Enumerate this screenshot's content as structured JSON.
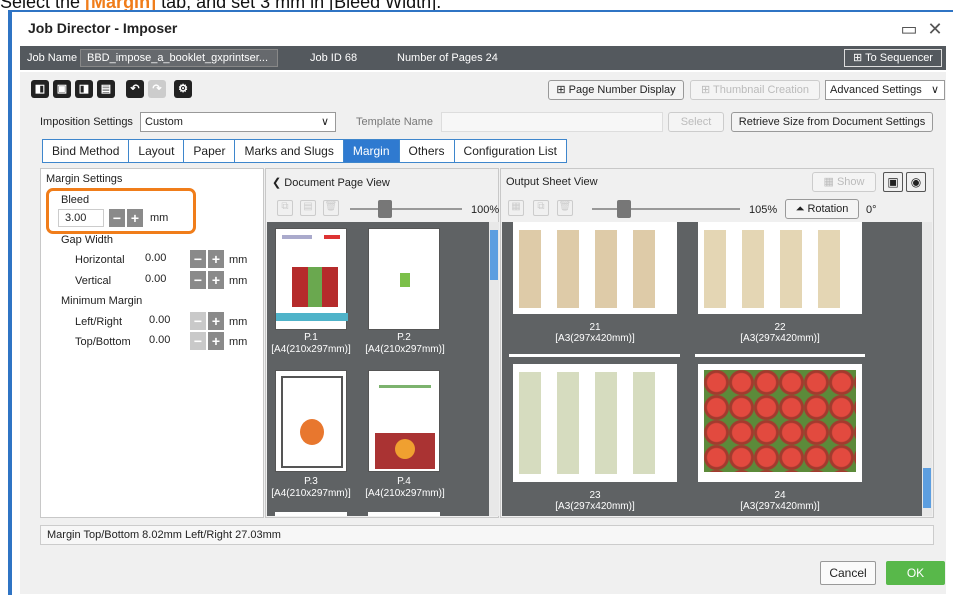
{
  "caption": {
    "prefix": "Select the ",
    "highlight": "[Margin]",
    "suffix": " tab, and set 3 mm in [Bleed Width]."
  },
  "window": {
    "title": "Job Director - Imposer",
    "maximize_icon": "maximize-icon",
    "close_icon": "close-icon"
  },
  "info": {
    "job_name_label": "Job Name",
    "job_name_value": "BBD_impose_a_booklet_gxprintser...",
    "job_id": "Job ID  68",
    "pages": "Number of Pages  24",
    "sequencer_btn": "To Sequencer"
  },
  "toolbar": {
    "page_number_display": "Page Number Display",
    "thumbnail_creation": "Thumbnail Creation",
    "advanced_settings": "Advanced Settings"
  },
  "settings": {
    "imposition_label": "Imposition Settings",
    "imposition_value": "Custom",
    "template_label": "Template Name",
    "select_btn": "Select",
    "retrieve_btn": "Retrieve Size from Document Settings"
  },
  "tabs": [
    "Bind Method",
    "Layout",
    "Paper",
    "Marks and Slugs",
    "Margin",
    "Others",
    "Configuration List"
  ],
  "margin": {
    "title": "Margin Settings",
    "bleed_label": "Bleed",
    "bleed_value": "3.00",
    "unit": "mm",
    "gap_label": "Gap Width",
    "horizontal_label": "Horizontal",
    "horizontal_value": "0.00",
    "vertical_label": "Vertical",
    "vertical_value": "0.00",
    "min_margin_label": "Minimum Margin",
    "leftright_label": "Left/Right",
    "leftright_value": "0.00",
    "topbottom_label": "Top/Bottom",
    "topbottom_value": "0.00"
  },
  "doc_view": {
    "title": "Document Page View",
    "zoom": "100%",
    "pages": [
      {
        "label": "P.1",
        "size": "[A4(210x297mm)]"
      },
      {
        "label": "P.2",
        "size": "[A4(210x297mm)]"
      },
      {
        "label": "P.3",
        "size": "[A4(210x297mm)]"
      },
      {
        "label": "P.4",
        "size": "[A4(210x297mm)]"
      }
    ]
  },
  "sheet_view": {
    "title": "Output Sheet View",
    "show_btn": "Show",
    "zoom": "105%",
    "rotation_btn": "Rotation",
    "rotation_value": "0°",
    "sheets": [
      {
        "label": "21",
        "size": "[A3(297x420mm)]"
      },
      {
        "label": "22",
        "size": "[A3(297x420mm)]"
      },
      {
        "label": "23",
        "size": "[A3(297x420mm)]"
      },
      {
        "label": "24",
        "size": "[A3(297x420mm)]"
      }
    ]
  },
  "status": {
    "text": "Margin  Top/Bottom  8.02mm  Left/Right  27.03mm"
  },
  "footer": {
    "cancel": "Cancel",
    "ok": "OK"
  },
  "colors": {
    "accent": "#2f7ad0",
    "highlight": "#f07d1a",
    "ok": "#58b84a"
  }
}
